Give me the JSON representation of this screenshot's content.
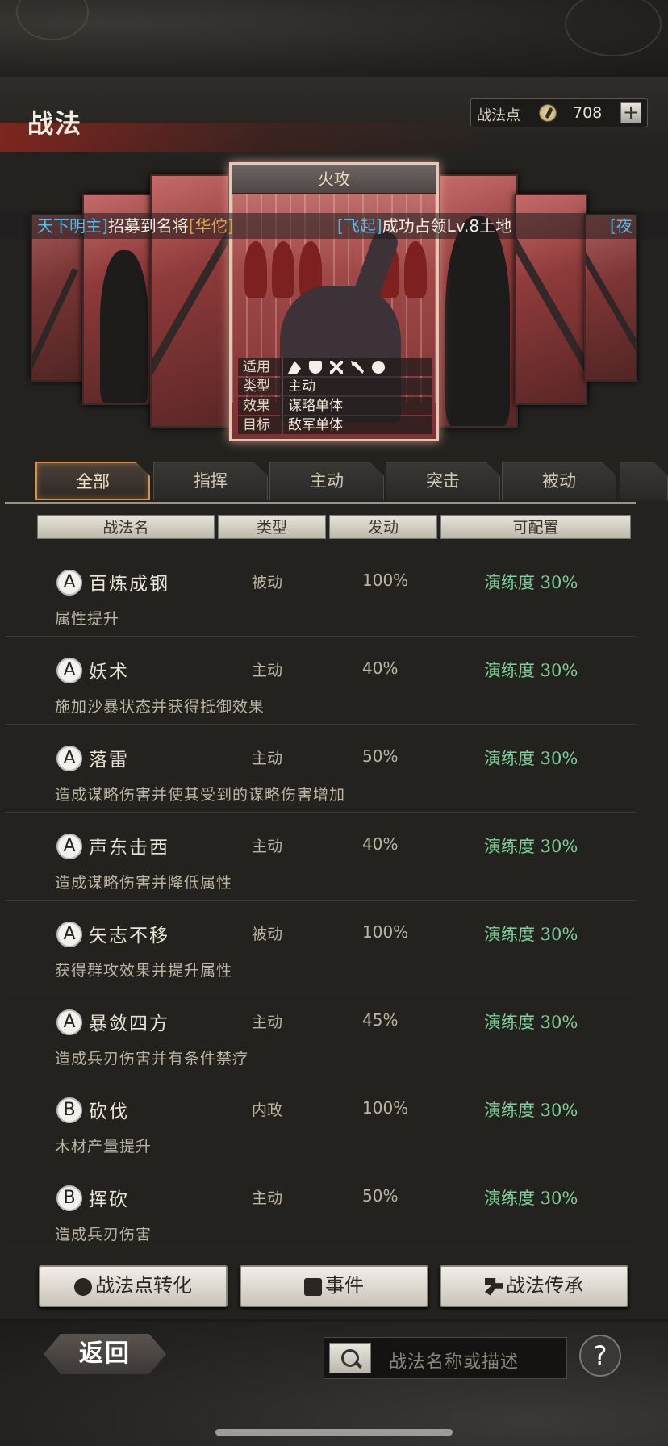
{
  "header": {
    "title": "战法",
    "points_label": "战法点",
    "points_value": "708",
    "plus": "+"
  },
  "featured_card": {
    "title": "火攻",
    "attrs": [
      {
        "key": "适用",
        "value": ""
      },
      {
        "key": "类型",
        "value": "主动"
      },
      {
        "key": "效果",
        "value": "谋略单体"
      },
      {
        "key": "目标",
        "value": "敌军单体"
      }
    ],
    "unit_icons": [
      "cavalry-icon",
      "shield-icon",
      "archer-icon",
      "spear-icon",
      "siege-icon"
    ]
  },
  "ticker": {
    "p1_bracket_open": "天下明主]",
    "p1_text": "招募到名将",
    "p1_name": "[华佗]",
    "p2_name": "[飞起]",
    "p2_text": "成功占领Lv.8土地",
    "p3": "[夜"
  },
  "tabs": [
    "全部",
    "指挥",
    "主动",
    "突击",
    "被动"
  ],
  "columns": [
    "战法名",
    "类型",
    "发动",
    "可配置"
  ],
  "tactics": [
    {
      "grade": "A",
      "name": "百炼成钢",
      "type": "被动",
      "rate": "100%",
      "practice": "演练度 30%",
      "desc": "属性提升"
    },
    {
      "grade": "A",
      "name": "妖术",
      "type": "主动",
      "rate": "40%",
      "practice": "演练度 30%",
      "desc": "施加沙暴状态并获得抵御效果"
    },
    {
      "grade": "A",
      "name": "落雷",
      "type": "主动",
      "rate": "50%",
      "practice": "演练度 30%",
      "desc": "造成谋略伤害并使其受到的谋略伤害增加"
    },
    {
      "grade": "A",
      "name": "声东击西",
      "type": "主动",
      "rate": "40%",
      "practice": "演练度 30%",
      "desc": "造成谋略伤害并降低属性"
    },
    {
      "grade": "A",
      "name": "矢志不移",
      "type": "被动",
      "rate": "100%",
      "practice": "演练度 30%",
      "desc": "获得群攻效果并提升属性"
    },
    {
      "grade": "A",
      "name": "暴敛四方",
      "type": "主动",
      "rate": "45%",
      "practice": "演练度 30%",
      "desc": "造成兵刃伤害并有条件禁疗"
    },
    {
      "grade": "B",
      "name": "砍伐",
      "type": "内政",
      "rate": "100%",
      "practice": "演练度 30%",
      "desc": "木材产量提升"
    },
    {
      "grade": "B",
      "name": "挥砍",
      "type": "主动",
      "rate": "50%",
      "practice": "演练度 30%",
      "desc": "造成兵刃伤害"
    }
  ],
  "actions": {
    "convert": "战法点转化",
    "event": "事件",
    "inherit": "战法传承"
  },
  "footer": {
    "back": "返回",
    "search_placeholder": "战法名称或描述",
    "help": "?"
  }
}
